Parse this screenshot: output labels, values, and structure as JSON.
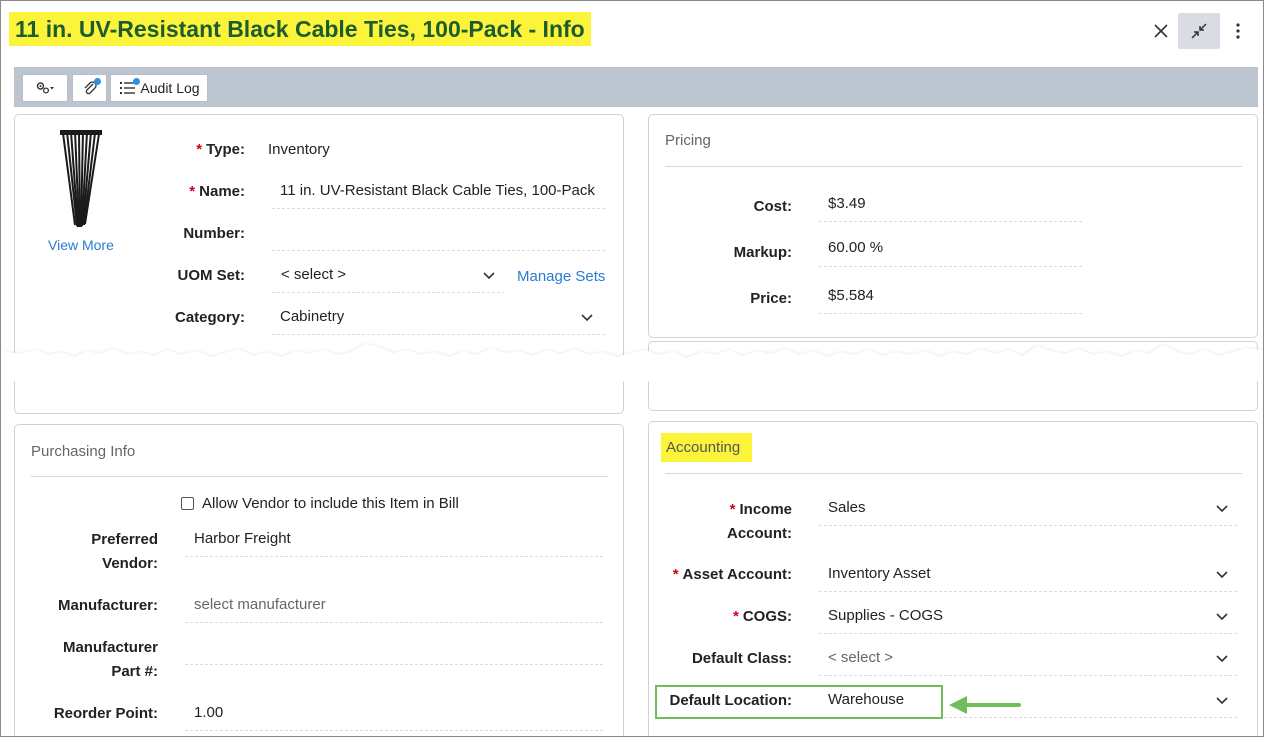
{
  "header": {
    "title": "11 in. UV-Resistant Black Cable Ties, 100-Pack - Info",
    "close_icon": "close-icon",
    "collapse_icon": "collapse-icon",
    "menu_icon": "kebab-icon"
  },
  "toolbar": {
    "settings_icon": "gears-icon",
    "attach_icon": "paperclip-icon",
    "audit_label": "Audit Log"
  },
  "item": {
    "view_more": "View More",
    "type_label": "Type:",
    "type_value": "Inventory",
    "name_label": "Name:",
    "name_value": "11 in. UV-Resistant Black Cable Ties, 100-Pack",
    "number_label": "Number:",
    "number_value": "",
    "uom_label": "UOM Set:",
    "uom_value": "< select >",
    "manage_sets": "Manage Sets",
    "category_label": "Category:",
    "category_value": "Cabinetry"
  },
  "pricing": {
    "title": "Pricing",
    "cost_label": "Cost:",
    "cost_value": "$3.49",
    "markup_label": "Markup:",
    "markup_value": "60.00 %",
    "price_label": "Price:",
    "price_value": "$5.584"
  },
  "purchasing": {
    "title": "Purchasing Info",
    "allow_vendor_label": "Allow Vendor to include this Item in Bill",
    "allow_vendor_checked": false,
    "preferred_vendor_label_1": "Preferred",
    "preferred_vendor_label_2": "Vendor:",
    "preferred_vendor_value": "Harbor Freight",
    "manufacturer_label": "Manufacturer:",
    "manufacturer_placeholder": "select manufacturer",
    "part_label_1": "Manufacturer",
    "part_label_2": "Part #:",
    "part_value": "",
    "reorder_label": "Reorder Point:",
    "reorder_value": "1.00"
  },
  "accounting": {
    "title": "Accounting",
    "income_label_1": "Income",
    "income_label_2": "Account:",
    "income_value": "Sales",
    "asset_label": "Asset Account:",
    "asset_value": "Inventory Asset",
    "cogs_label": "COGS:",
    "cogs_value": "Supplies - COGS",
    "class_label": "Default Class:",
    "class_value": "< select >",
    "location_label": "Default Location:",
    "location_value": "Warehouse"
  },
  "colors": {
    "highlight": "#fbf43a",
    "title_text": "#1c5c2e",
    "toolbar_bg": "#bcc4cf",
    "link": "#2a7bd1",
    "required": "#d0021b",
    "callout_green": "#6fbe5a"
  }
}
